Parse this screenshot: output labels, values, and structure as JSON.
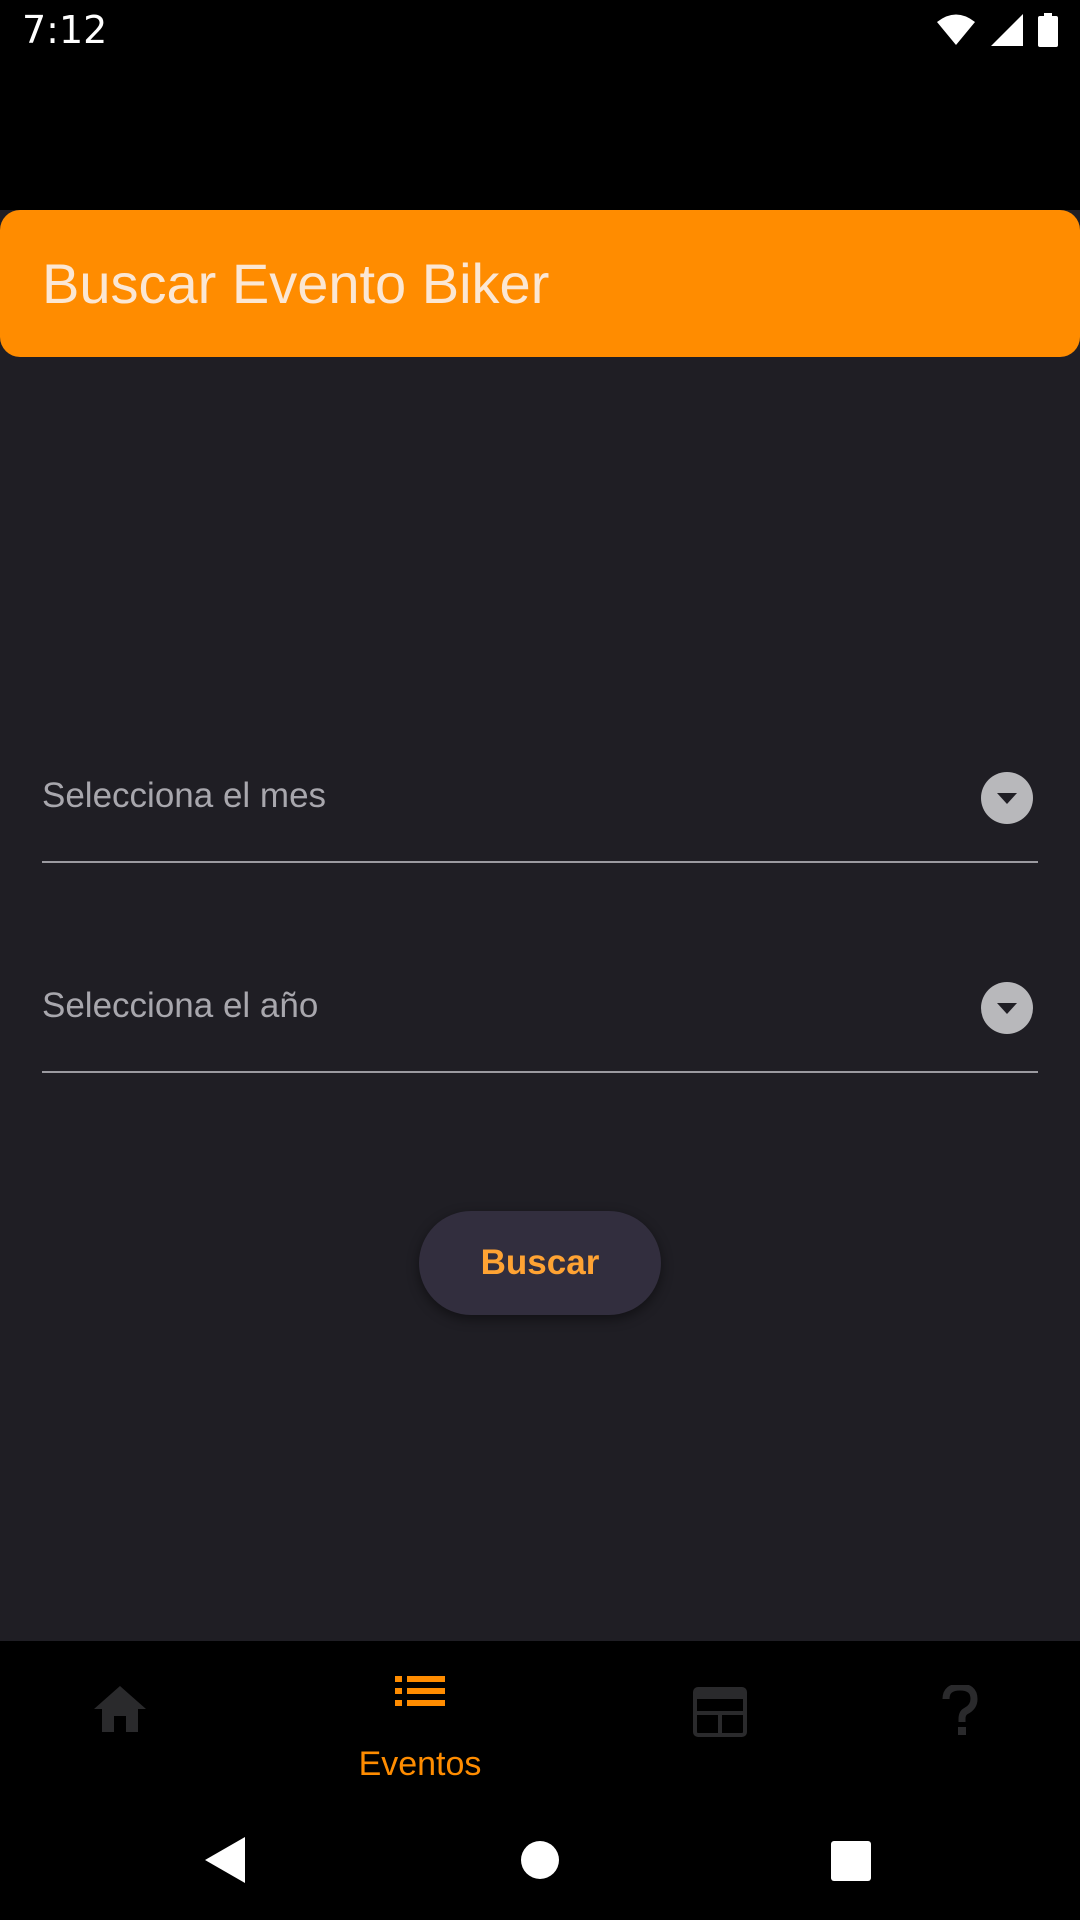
{
  "status_bar": {
    "time": "7:12",
    "icons": [
      "wifi-icon",
      "signal-icon",
      "battery-icon"
    ]
  },
  "app_bar": {
    "title": "Buscar Evento Biker",
    "color": "#ff8c00"
  },
  "form": {
    "month_dropdown": {
      "placeholder": "Selecciona el mes"
    },
    "year_dropdown": {
      "placeholder": "Selecciona el año"
    },
    "search_button": "Buscar"
  },
  "bottom_nav": {
    "active_color": "#ff8c00",
    "items": [
      {
        "icon": "home-icon",
        "label": ""
      },
      {
        "icon": "list-icon",
        "label": "Eventos",
        "active": true
      },
      {
        "icon": "calendar-icon",
        "label": ""
      },
      {
        "icon": "help-icon",
        "label": ""
      }
    ]
  },
  "system_nav": {
    "icons": [
      "back-icon",
      "home-circle-icon",
      "recents-icon"
    ]
  }
}
